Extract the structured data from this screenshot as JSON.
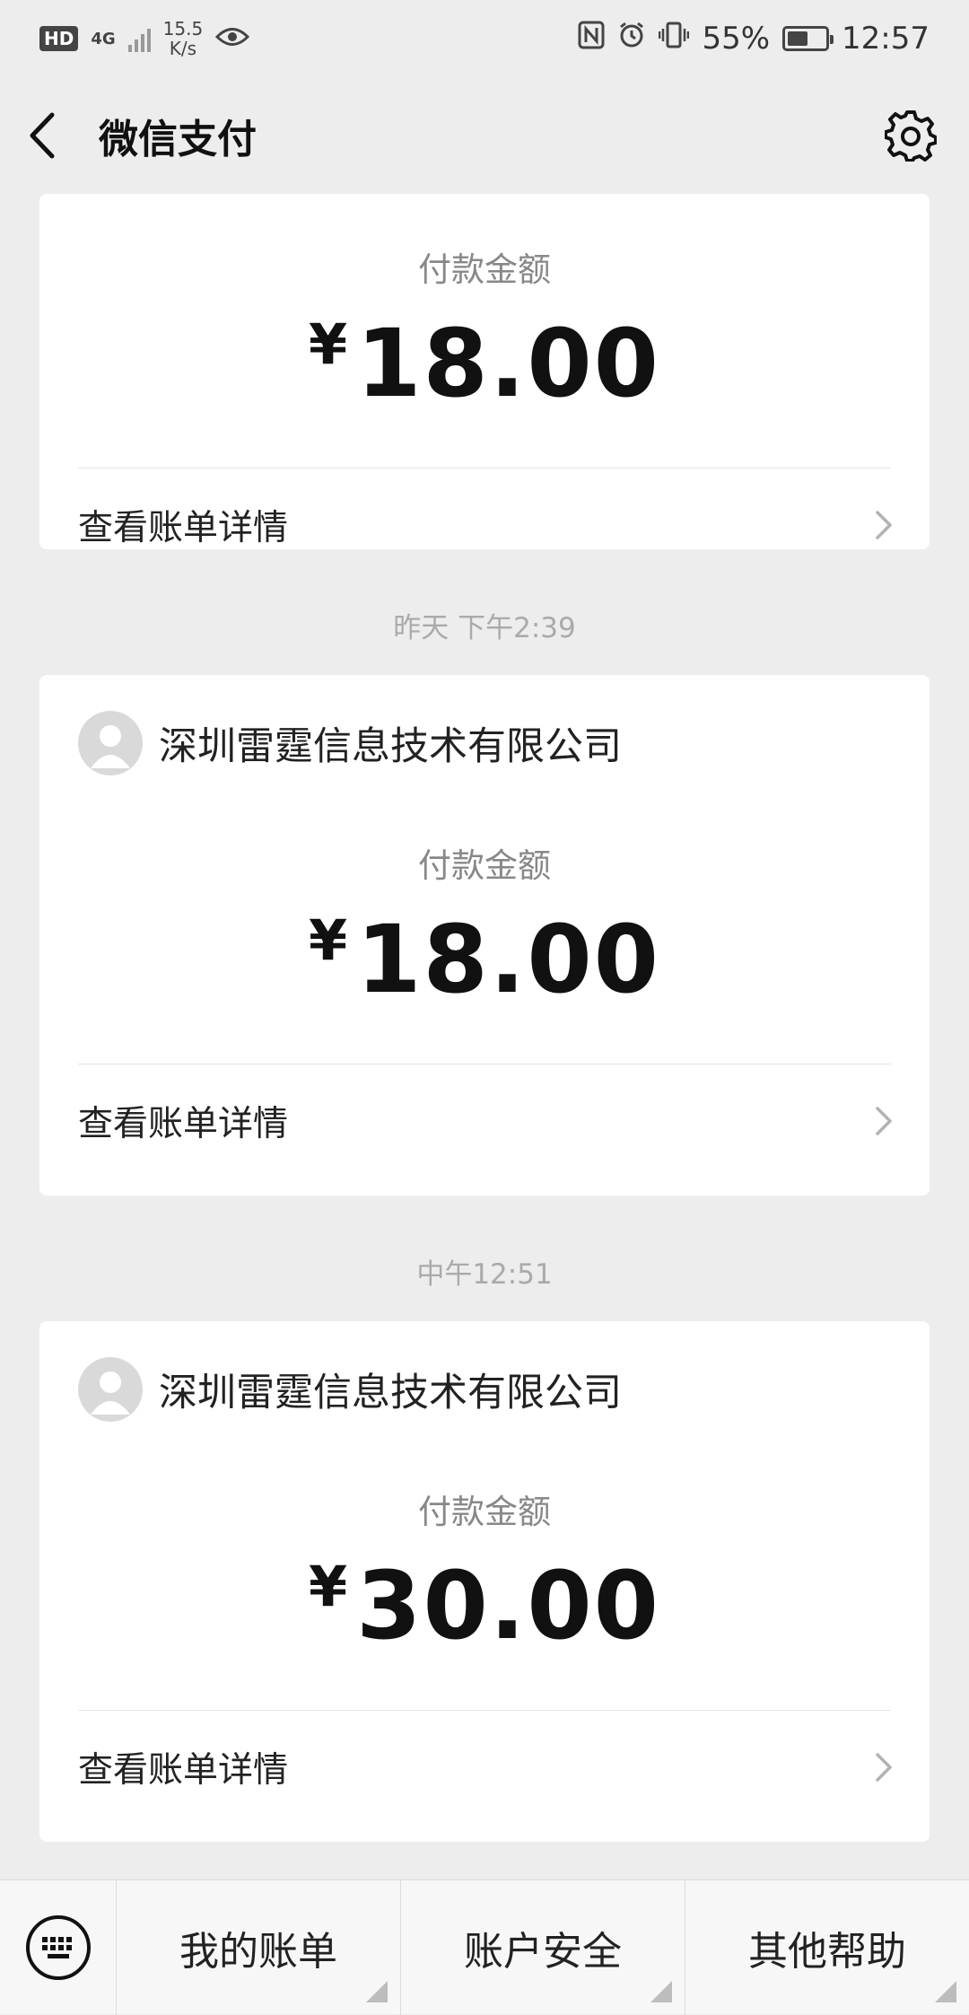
{
  "status_bar": {
    "hd": "HD",
    "network": "4G",
    "speed_value": "15.5",
    "speed_unit": "K/s",
    "battery": "55%",
    "time": "12:57"
  },
  "nav": {
    "title": "微信支付"
  },
  "cards": [
    {
      "amount_label": "付款金额",
      "currency": "¥",
      "amount": "18.00",
      "detail_label": "查看账单详情"
    },
    {
      "merchant": "深圳雷霆信息技术有限公司",
      "amount_label": "付款金额",
      "currency": "¥",
      "amount": "18.00",
      "detail_label": "查看账单详情"
    },
    {
      "merchant": "深圳雷霆信息技术有限公司",
      "amount_label": "付款金额",
      "currency": "¥",
      "amount": "30.00",
      "detail_label": "查看账单详情"
    }
  ],
  "timestamps": [
    "昨天 下午2:39",
    "中午12:51"
  ],
  "bottom_menu": {
    "items": [
      "我的账单",
      "账户安全",
      "其他帮助"
    ]
  },
  "colors": {
    "background": "#ededed",
    "card": "#ffffff",
    "muted_text": "#888888"
  }
}
